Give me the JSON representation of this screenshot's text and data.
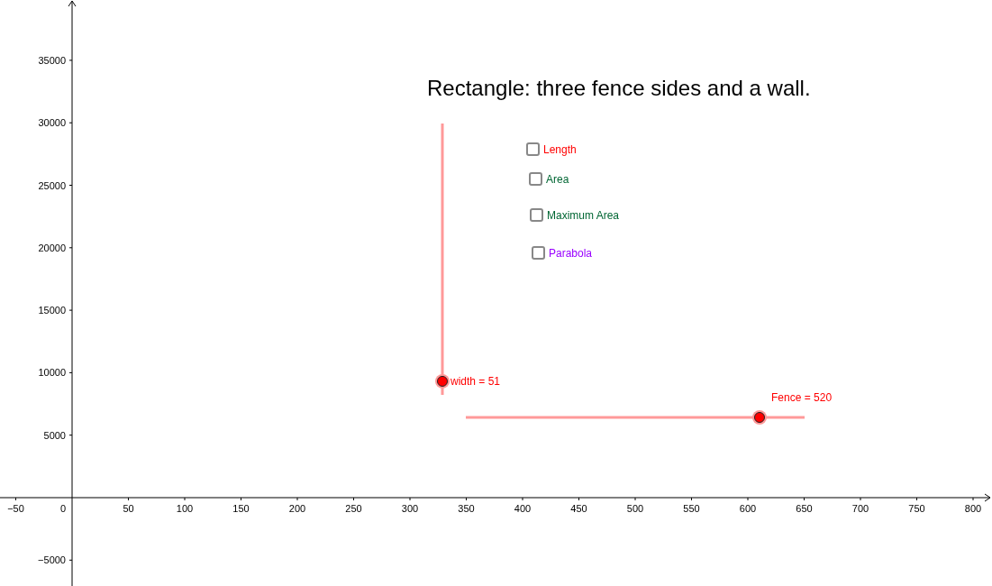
{
  "title": "Rectangle: three fence sides and a wall.",
  "x_axis": {
    "labels": [
      "−50",
      "0",
      "50",
      "100",
      "150",
      "200",
      "250",
      "300",
      "350",
      "400",
      "450",
      "500",
      "550",
      "600",
      "650",
      "700",
      "750",
      "800"
    ]
  },
  "y_axis": {
    "labels": [
      "35000",
      "30000",
      "25000",
      "20000",
      "15000",
      "10000",
      "5000",
      "−5000"
    ]
  },
  "checkboxes": [
    {
      "label": "Length",
      "checked": false,
      "color": "#ff0000"
    },
    {
      "label": "Area",
      "checked": false,
      "color": "#006633"
    },
    {
      "label": "Maximum Area",
      "checked": false,
      "color": "#006633"
    },
    {
      "label": "Parabola",
      "checked": false,
      "color": "#9900ff"
    }
  ],
  "sliders": [
    {
      "kind": "vertical",
      "label": "width = 51",
      "level": 0.05
    },
    {
      "kind": "horizontal",
      "label": "Fence = 520",
      "level": 0.867
    }
  ]
}
